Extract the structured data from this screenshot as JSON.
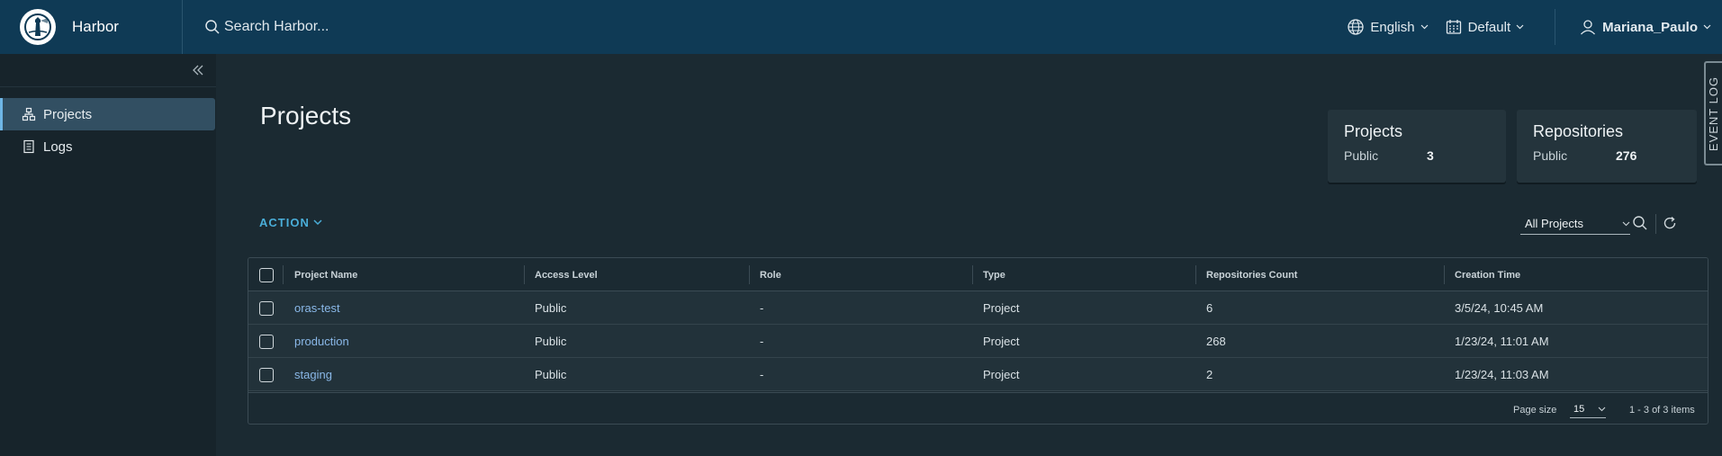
{
  "header": {
    "brand": "Harbor",
    "search_placeholder": "Search Harbor...",
    "language": "English",
    "theme": "Default",
    "user": "Mariana_Paulo"
  },
  "sidebar": {
    "items": [
      {
        "label": "Projects",
        "icon": "projects-icon",
        "active": true
      },
      {
        "label": "Logs",
        "icon": "logs-icon",
        "active": false
      }
    ]
  },
  "main": {
    "title": "Projects",
    "cards": [
      {
        "title": "Projects",
        "label": "Public",
        "value": "3"
      },
      {
        "title": "Repositories",
        "label": "Public",
        "value": "276"
      }
    ],
    "event_log": "EVENT LOG",
    "action": "ACTION",
    "filter": "All Projects"
  },
  "table": {
    "headers": [
      "Project Name",
      "Access Level",
      "Role",
      "Type",
      "Repositories Count",
      "Creation Time"
    ],
    "rows": [
      {
        "name": "oras-test",
        "access": "Public",
        "role": "-",
        "type": "Project",
        "repos": "6",
        "created": "3/5/24, 10:45 AM"
      },
      {
        "name": "production",
        "access": "Public",
        "role": "-",
        "type": "Project",
        "repos": "268",
        "created": "1/23/24, 11:01 AM"
      },
      {
        "name": "staging",
        "access": "Public",
        "role": "-",
        "type": "Project",
        "repos": "2",
        "created": "1/23/24, 11:03 AM"
      }
    ],
    "page_size_label": "Page size",
    "page_size": "15",
    "pagination": "1 - 3 of 3 items"
  }
}
